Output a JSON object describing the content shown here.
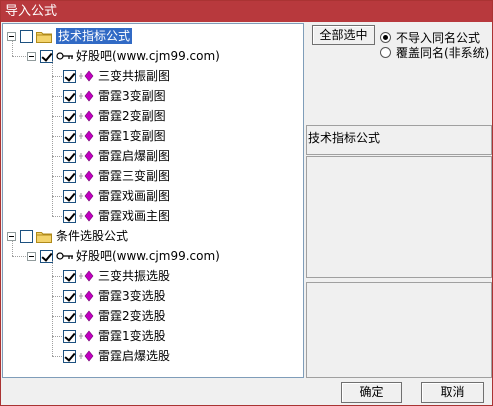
{
  "window": {
    "title": "导入公式"
  },
  "tree": {
    "group1": {
      "label": "技术指标公式",
      "source": "好股吧(www.cjm99.com)",
      "items": [
        "三变共振副图",
        "雷霆3变副图",
        "雷霆2变副图",
        "雷霆1变副图",
        "雷霆启爆副图",
        "雷霆三变副图",
        "雷霆戏画副图",
        "雷霆戏画主图"
      ]
    },
    "group2": {
      "label": "条件选股公式",
      "source": "好股吧(www.cjm99.com)",
      "items": [
        "三变共振选股",
        "雷霆3变选股",
        "雷霆2变选股",
        "雷霆1变选股",
        "雷霆启爆选股"
      ]
    }
  },
  "options": {
    "select_all_label": "全部选中",
    "radio_skip_label": "不导入同名公式",
    "radio_overwrite_label": "覆盖同名(非系统)",
    "selected": "skip"
  },
  "info": {
    "type_label": "技术指标公式"
  },
  "buttons": {
    "ok": "确定",
    "cancel": "取消"
  },
  "colors": {
    "titlebar": "#b8393d",
    "selection": "#316ac5",
    "leaf_icon": "#c000c0"
  }
}
